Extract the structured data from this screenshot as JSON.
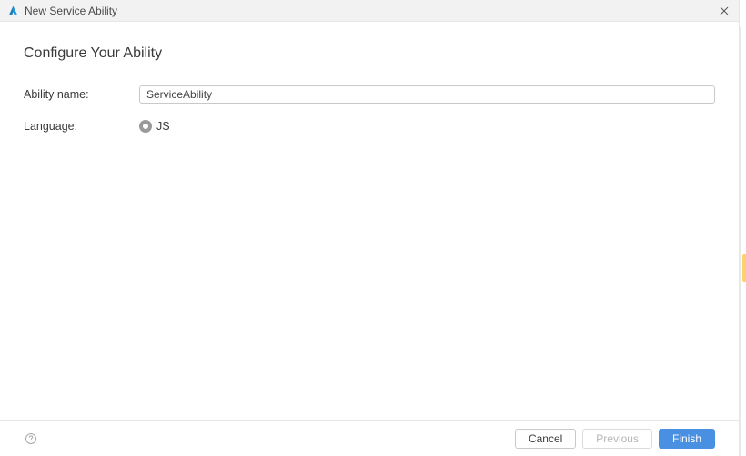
{
  "titlebar": {
    "title": "New Service Ability"
  },
  "heading": "Configure Your Ability",
  "form": {
    "ability_name": {
      "label": "Ability name:",
      "value": "ServiceAbility"
    },
    "language": {
      "label": "Language:",
      "options": [
        "JS"
      ],
      "selected": "JS"
    }
  },
  "footer": {
    "cancel": "Cancel",
    "previous": "Previous",
    "finish": "Finish"
  },
  "colors": {
    "primary": "#4a90e2",
    "logo": "#2196d6"
  }
}
